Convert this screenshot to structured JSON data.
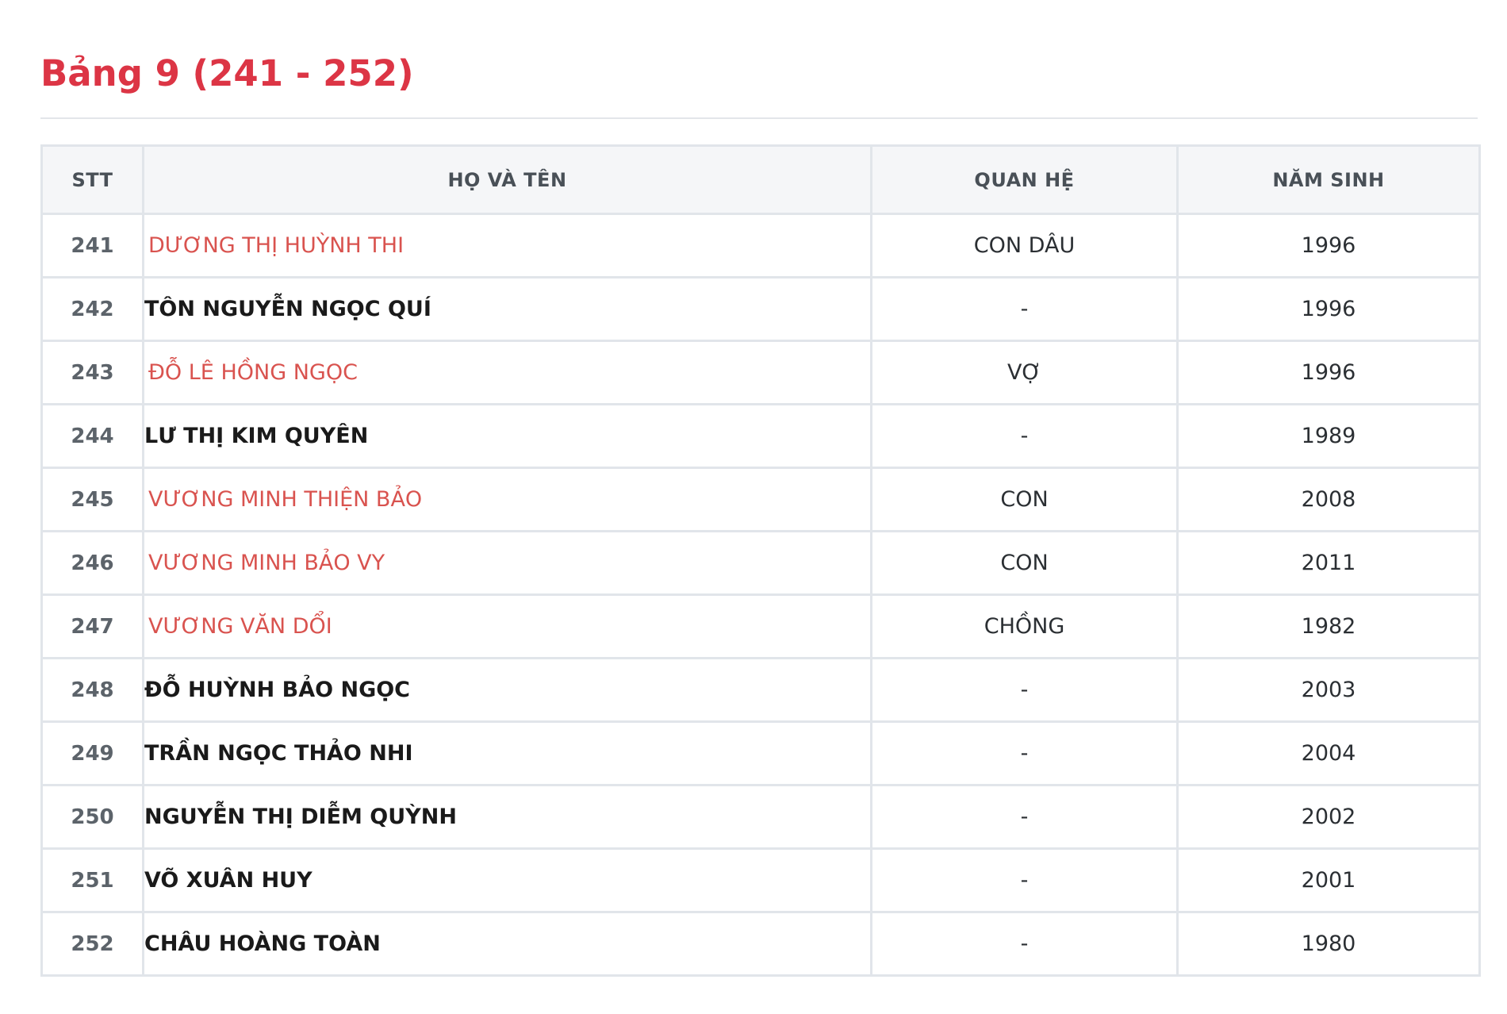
{
  "title": "Bảng 9 (241 - 252)",
  "table": {
    "headers": [
      "STT",
      "HỌ VÀ TÊN",
      "QUAN HỆ",
      "NĂM SINH"
    ],
    "rows": [
      {
        "stt": "241",
        "name": "DƯƠNG THỊ HUỲNH THI",
        "relation": "CON DÂU",
        "year": "1996",
        "is_member": true
      },
      {
        "stt": "242",
        "name": "TÔN NGUYỄN NGỌC QUÍ",
        "relation": "-",
        "year": "1996",
        "is_member": false
      },
      {
        "stt": "243",
        "name": "ĐỖ LÊ HỒNG NGỌC",
        "relation": "VỢ",
        "year": "1996",
        "is_member": true
      },
      {
        "stt": "244",
        "name": "LƯ THỊ KIM QUYÊN",
        "relation": "-",
        "year": "1989",
        "is_member": false
      },
      {
        "stt": "245",
        "name": "VƯƠNG MINH THIỆN BẢO",
        "relation": "CON",
        "year": "2008",
        "is_member": true
      },
      {
        "stt": "246",
        "name": "VƯƠNG MINH BẢO VY",
        "relation": "CON",
        "year": "2011",
        "is_member": true
      },
      {
        "stt": "247",
        "name": "VƯƠNG VĂN DỔI",
        "relation": "CHỒNG",
        "year": "1982",
        "is_member": true
      },
      {
        "stt": "248",
        "name": "ĐỖ HUỲNH BẢO NGỌC",
        "relation": "-",
        "year": "2003",
        "is_member": false
      },
      {
        "stt": "249",
        "name": "TRẦN NGỌC THẢO NHI",
        "relation": "-",
        "year": "2004",
        "is_member": false
      },
      {
        "stt": "250",
        "name": "NGUYỄN THỊ DIỄM QUỲNH",
        "relation": "-",
        "year": "2002",
        "is_member": false
      },
      {
        "stt": "251",
        "name": "VÕ XUÂN HUY",
        "relation": "-",
        "year": "2001",
        "is_member": false
      },
      {
        "stt": "252",
        "name": "CHÂU HOÀNG TOÀN",
        "relation": "-",
        "year": "1980",
        "is_member": false
      }
    ]
  },
  "colors": {
    "title": "#dc3545",
    "member_name": "#d9534f",
    "head_name": "#1a1a1a",
    "header_bg": "#f5f6f8",
    "border": "#e1e5ea"
  }
}
